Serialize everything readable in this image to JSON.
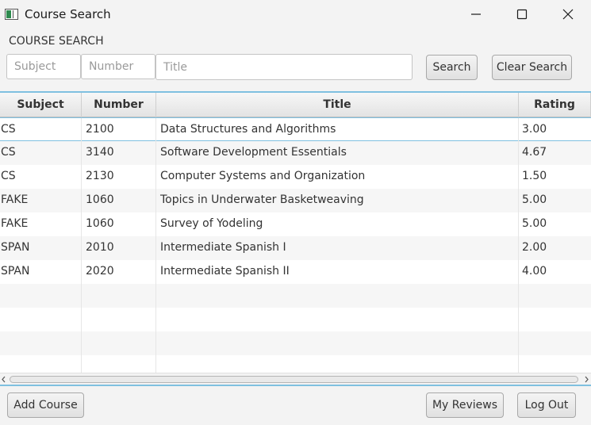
{
  "window": {
    "title": "Course Search",
    "icons": {
      "app": "app-window-icon",
      "minimize": "minimize-icon",
      "maximize": "maximize-icon",
      "close": "close-icon"
    }
  },
  "search": {
    "section_label": "COURSE SEARCH",
    "subject_placeholder": "Subject",
    "subject_value": "",
    "number_placeholder": "Number",
    "number_value": "",
    "title_placeholder": "Title",
    "title_value": "",
    "search_label": "Search",
    "clear_label": "Clear Search"
  },
  "table": {
    "columns": [
      "Subject",
      "Number",
      "Title",
      "Rating"
    ],
    "selected_row": 0,
    "rows": [
      [
        "CS",
        "2100",
        "Data Structures and Algorithms",
        "3.00"
      ],
      [
        "CS",
        "3140",
        "Software Development Essentials",
        "4.67"
      ],
      [
        "CS",
        "2130",
        "Computer Systems and Organization",
        "1.50"
      ],
      [
        "FAKE",
        "1060",
        "Topics in Underwater Basketweaving",
        "5.00"
      ],
      [
        "FAKE",
        "1060",
        "Survey of Yodeling",
        "5.00"
      ],
      [
        "SPAN",
        "2010",
        "Intermediate Spanish I",
        "2.00"
      ],
      [
        "SPAN",
        "2020",
        "Intermediate Spanish II",
        "4.00"
      ],
      [
        "",
        "",
        "",
        ""
      ],
      [
        "",
        "",
        "",
        ""
      ],
      [
        "",
        "",
        "",
        ""
      ],
      [
        "",
        "",
        "",
        ""
      ]
    ]
  },
  "footer": {
    "add_course_label": "Add Course",
    "my_reviews_label": "My Reviews",
    "log_out_label": "Log Out"
  },
  "colors": {
    "accent": "#7fc0e0",
    "background": "#f3f3f3"
  }
}
